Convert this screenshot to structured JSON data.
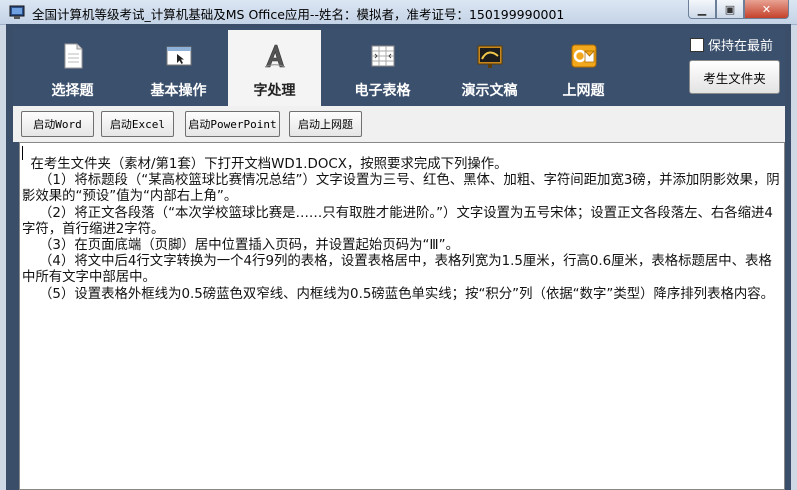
{
  "window": {
    "title": "全国计算机等级考试_计算机基础及MS Office应用--姓名：模拟者，准考证号：150199990001",
    "minimize": "▁",
    "maximize": "▣",
    "close": "✕"
  },
  "nav": {
    "tabs": [
      {
        "label": "选择题",
        "icon": "document-icon"
      },
      {
        "label": "基本操作",
        "icon": "window-cursor-icon"
      },
      {
        "label": "字处理",
        "icon": "letter-a-icon",
        "active": true
      },
      {
        "label": "电子表格",
        "icon": "spreadsheet-icon"
      },
      {
        "label": "演示文稿",
        "icon": "slideshow-icon"
      },
      {
        "label": "上网题",
        "icon": "outlook-icon"
      }
    ],
    "keep_front_label": "保持在最前",
    "folder_button": "考生文件夹"
  },
  "toolbar": {
    "word": "启动Word",
    "excel": "启动Excel",
    "powerpoint": "启动PowerPoint",
    "internet": "启动上网题"
  },
  "content": {
    "lines": [
      "  在考生文件夹（素材/第1套）下打开文档WD1.DOCX，按照要求完成下列操作。",
      "    （1）将标题段（“某高校篮球比赛情况总结”）文字设置为三号、红色、黑体、加粗、字符间距加宽3磅，并添加阴影效果，阴影效果的“预设”值为“内部右上角”。",
      "    （2）将正文各段落（“本次学校篮球比赛是……只有取胜才能进阶。”）文字设置为五号宋体；设置正文各段落左、右各缩进4字符，首行缩进2字符。",
      "    （3）在页面底端（页脚）居中位置插入页码，并设置起始页码为“Ⅲ”。",
      "    （4）将文中后4行文字转换为一个4行9列的表格，设置表格居中，表格列宽为1.5厘米，行高0.6厘米，表格标题居中、表格中所有文字中部居中。",
      "    （5）设置表格外框线为0.5磅蓝色双窄线、内框线为0.5磅蓝色单实线；按“积分”列（依据“数字”类型）降序排列表格内容。"
    ]
  }
}
